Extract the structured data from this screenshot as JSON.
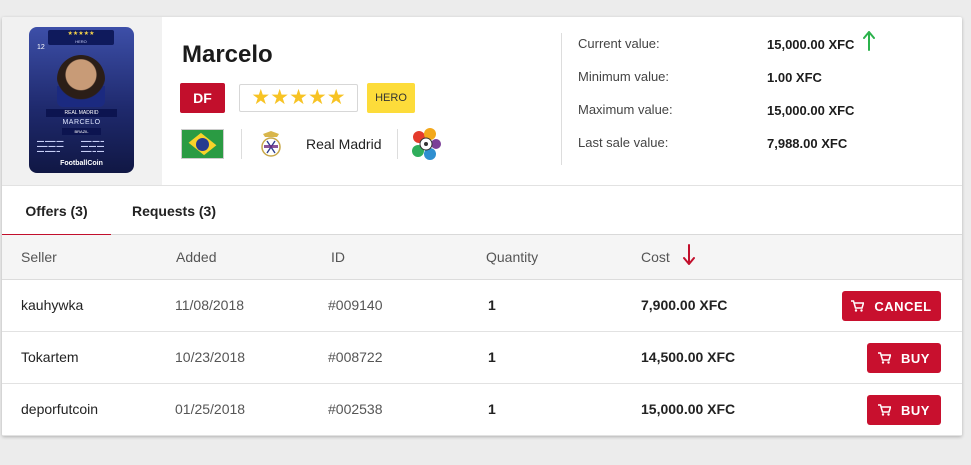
{
  "player": {
    "name": "Marcelo",
    "position": "DF",
    "stars": "★★★★★",
    "rarity": "HERO",
    "club": "Real Madrid",
    "nationality_flag": "brazil-flag",
    "league_logo": "laliga-logo"
  },
  "card": {
    "number": "12",
    "stars": "★★★★★",
    "rarity": "HERO",
    "club": "REAL MADRID",
    "name": "MARCELO",
    "country": "BRAZIL",
    "brand": "FootballCoin"
  },
  "values": {
    "current_label": "Current value:",
    "current_value": "15,000.00 XFC",
    "minimum_label": "Minimum value:",
    "minimum_value": "1.00 XFC",
    "maximum_label": "Maximum value:",
    "maximum_value": "15,000.00 XFC",
    "last_sale_label": "Last sale value:",
    "last_sale_value": "7,988.00 XFC",
    "trend_color": "#2bb24c"
  },
  "tabs": [
    {
      "label": "Offers (3)",
      "active": true
    },
    {
      "label": "Requests (3)",
      "active": false
    }
  ],
  "table": {
    "columns": [
      "Seller",
      "Added",
      "ID",
      "Quantity",
      "Cost"
    ],
    "sort_color": "#c20f2c",
    "rows": [
      {
        "seller": "kauhywka",
        "added": "11/08/2018",
        "id": "#009140",
        "quantity": "1",
        "cost": "7,900.00 XFC",
        "action": "CANCEL"
      },
      {
        "seller": "Tokartem",
        "added": "10/23/2018",
        "id": "#008722",
        "quantity": "1",
        "cost": "14,500.00 XFC",
        "action": "BUY"
      },
      {
        "seller": "deporfutcoin",
        "added": "01/25/2018",
        "id": "#002538",
        "quantity": "1",
        "cost": "15,000.00 XFC",
        "action": "BUY"
      }
    ]
  },
  "colors": {
    "accent": "#c20f2c",
    "hero": "#fddc3a",
    "star": "#f7c324"
  }
}
